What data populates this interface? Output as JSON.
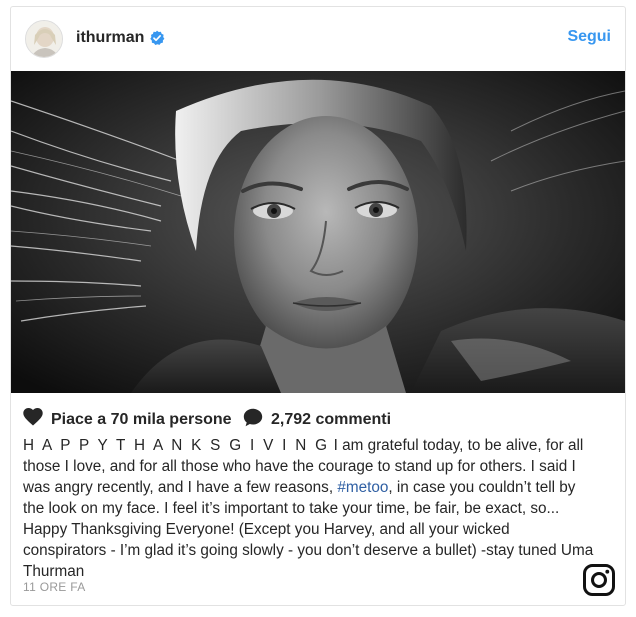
{
  "post": {
    "username": "ithurman",
    "verified": true,
    "follow_label": "Segui",
    "likes_text": "Piace a 70 mila persone",
    "comments_text": "2,792 commenti",
    "caption": {
      "part1": "H A P P Y T H A N K S G I V I N G",
      "part2": " I am grateful today, to be alive, for all those I love, and for all those who have the courage to stand up for others. I said I was angry recently, and I have a few reasons, ",
      "hashtag": "#metoo",
      "part3": ", in case you couldn’t tell by the look on my face. I feel it’s important to take your time, be fair, be exact, so... Happy Thanksgiving Everyone! (Except you Harvey, and all your wicked conspirators - I’m glad it’s going slowly - you don’t deserve a bullet) -stay tuned Uma Thurman"
    },
    "timestamp": "11 ORE FA"
  },
  "icons": {
    "verified": "verified-badge-icon",
    "like": "heart-icon",
    "comment": "comment-bubble-icon",
    "brand": "instagram-logo-icon"
  },
  "colors": {
    "accent": "#3897f0",
    "hashtag": "#2f5fa3",
    "text": "#262626",
    "muted": "#999999"
  }
}
